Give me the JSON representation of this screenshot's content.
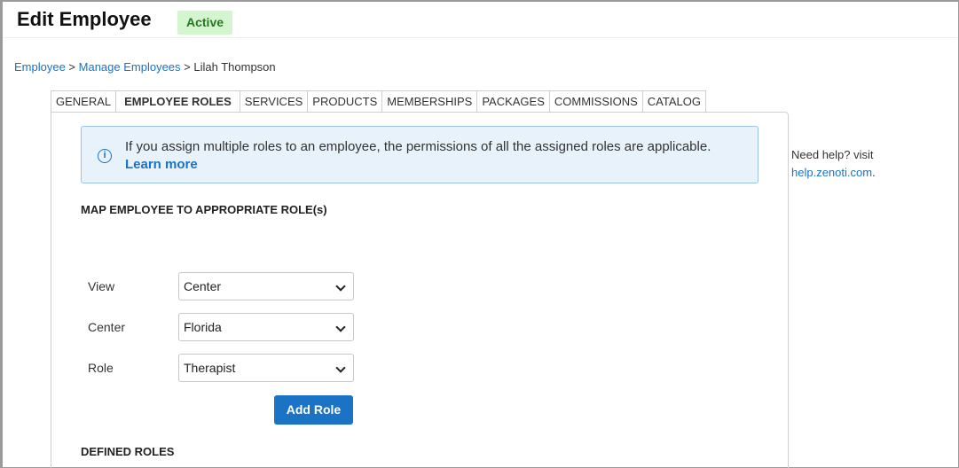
{
  "header": {
    "title": "Edit Employee",
    "status": "Active"
  },
  "breadcrumb": {
    "item1": "Employee",
    "sep1": " > ",
    "item2": "Manage Employees",
    "sep2": " > ",
    "current": "Lilah Thompson"
  },
  "tabs": [
    {
      "label": "GENERAL"
    },
    {
      "label": "EMPLOYEE ROLES"
    },
    {
      "label": "SERVICES"
    },
    {
      "label": "PRODUCTS"
    },
    {
      "label": "MEMBERSHIPS"
    },
    {
      "label": "PACKAGES"
    },
    {
      "label": "COMMISSIONS"
    },
    {
      "label": "CATALOG"
    }
  ],
  "info": {
    "text": "If you assign multiple roles to an employee, the permissions of all the assigned roles are applicable.",
    "link": "Learn more",
    "icon": "info-icon"
  },
  "map_section": {
    "title": "MAP EMPLOYEE TO APPROPRIATE ROLE(s)",
    "view_label": "View",
    "view_value": "Center",
    "center_label": "Center",
    "center_value": "Florida",
    "role_label": "Role",
    "role_value": "Therapist",
    "add_button": "Add Role"
  },
  "defined_section": {
    "title": "DEFINED ROLES"
  },
  "help": {
    "text": "Need help? visit",
    "link": "help.zenoti.com",
    "suffix": "."
  },
  "colors": {
    "accent": "#1a73c5",
    "badge_bg": "#d4f5d0",
    "badge_text": "#237a1f"
  }
}
